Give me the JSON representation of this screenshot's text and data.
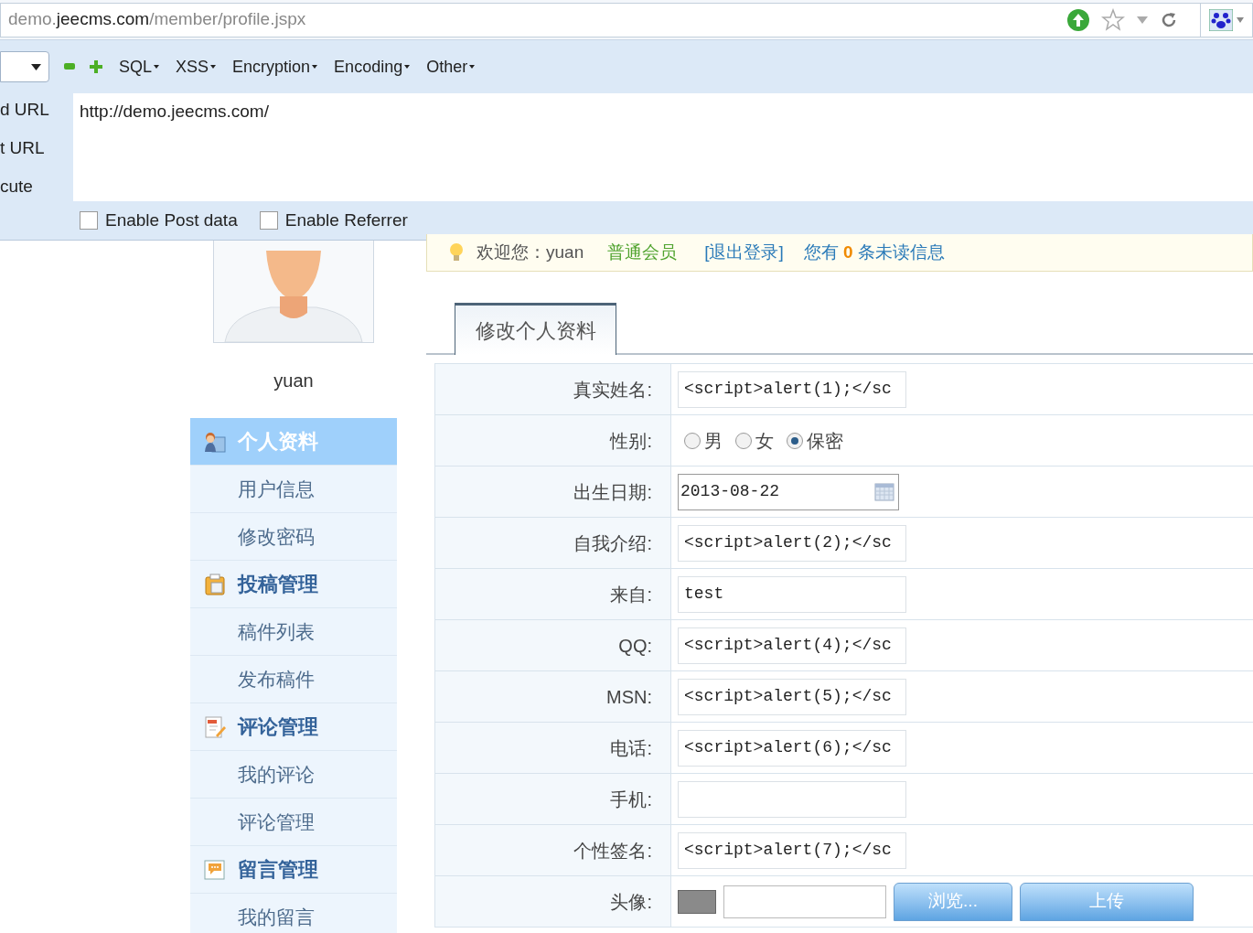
{
  "address_bar": {
    "url": [
      {
        "text": "demo.",
        "strong": false
      },
      {
        "text": "jeecms.com",
        "strong": true
      },
      {
        "text": "/member/profile.jspx",
        "strong": false
      }
    ]
  },
  "hackbar": {
    "menus": [
      "SQL",
      "XSS",
      "Encryption",
      "Encoding",
      "Other"
    ],
    "actions": [
      "d URL",
      "t URL",
      "cute"
    ],
    "url_value": "http://demo.jeecms.com/",
    "options": [
      {
        "label": "Enable Post data",
        "checked": false
      },
      {
        "label": "Enable Referrer",
        "checked": false
      }
    ]
  },
  "profile": {
    "username": "yuan"
  },
  "sidebar": {
    "items": [
      {
        "kind": "heading",
        "label": "个人资料",
        "selected": true
      },
      {
        "kind": "item",
        "label": "用户信息",
        "selected": false
      },
      {
        "kind": "item",
        "label": "修改密码",
        "selected": false
      },
      {
        "kind": "heading",
        "label": "投稿管理",
        "selected": false
      },
      {
        "kind": "item",
        "label": "稿件列表",
        "selected": false
      },
      {
        "kind": "item",
        "label": "发布稿件",
        "selected": false
      },
      {
        "kind": "heading",
        "label": "评论管理",
        "selected": false
      },
      {
        "kind": "item",
        "label": "我的评论",
        "selected": false
      },
      {
        "kind": "item",
        "label": "评论管理",
        "selected": false
      },
      {
        "kind": "heading",
        "label": "留言管理",
        "selected": false
      },
      {
        "kind": "item",
        "label": "我的留言",
        "selected": false
      }
    ]
  },
  "welcome_bar": {
    "greeting": "欢迎您：yuan",
    "member_level": "普通会员",
    "logout": "[退出登录]",
    "unread_prefix": "您有",
    "unread_count": "0",
    "unread_suffix": "条未读信息"
  },
  "tabs": [
    {
      "label": "修改个人资料",
      "selected": true
    }
  ],
  "form": {
    "rows": [
      {
        "kind": "text",
        "label": "真实姓名:",
        "value": "<script>alert(1);</sc"
      },
      {
        "kind": "radio",
        "label": "性别:",
        "options": [
          {
            "label": "男",
            "selected": false
          },
          {
            "label": "女",
            "selected": false
          },
          {
            "label": "保密",
            "selected": true
          }
        ]
      },
      {
        "kind": "date",
        "label": "出生日期:",
        "value": "2013-08-22"
      },
      {
        "kind": "text",
        "label": "自我介绍:",
        "value": "<script>alert(2);</sc"
      },
      {
        "kind": "text",
        "label": "来自:",
        "value": "test"
      },
      {
        "kind": "text",
        "label": "QQ:",
        "value": "<script>alert(4);</sc"
      },
      {
        "kind": "text",
        "label": "MSN:",
        "value": "<script>alert(5);</sc"
      },
      {
        "kind": "text",
        "label": "电话:",
        "value": "<script>alert(6);</sc"
      },
      {
        "kind": "text",
        "label": "手机:",
        "value": ""
      },
      {
        "kind": "text",
        "label": "个性签名:",
        "value": "<script>alert(7);</sc"
      },
      {
        "kind": "file",
        "label": "头像:",
        "buttons": [
          "浏览...",
          "上传"
        ]
      }
    ]
  }
}
